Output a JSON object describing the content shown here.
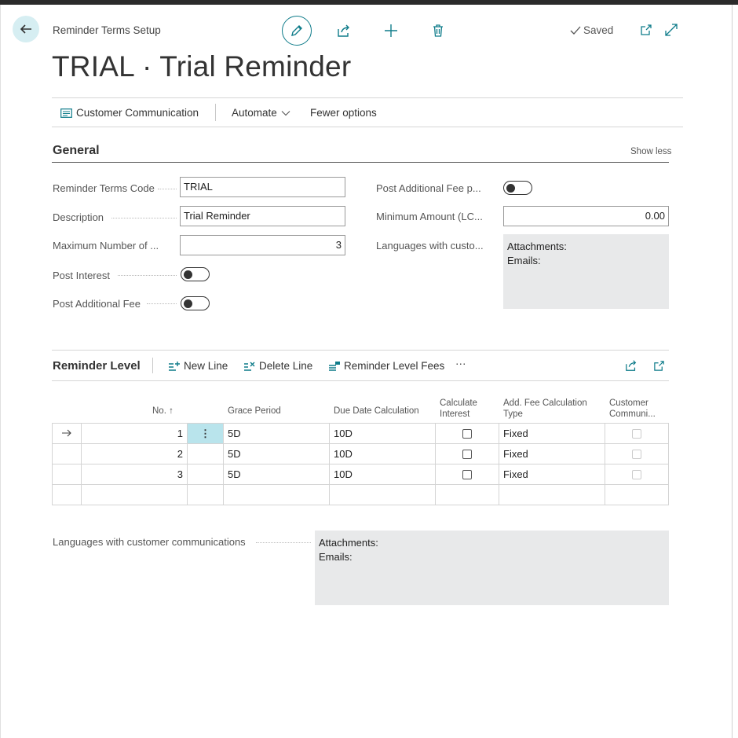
{
  "header": {
    "breadcrumb": "Reminder Terms Setup",
    "title": "TRIAL · Trial Reminder",
    "saved_label": "Saved"
  },
  "action_bar": {
    "customer_communication": "Customer Communication",
    "automate": "Automate",
    "fewer_options": "Fewer options"
  },
  "general": {
    "title": "General",
    "show_less": "Show less",
    "reminder_terms_code_label": "Reminder Terms Code",
    "reminder_terms_code_value": "TRIAL",
    "description_label": "Description",
    "description_value": "Trial Reminder",
    "max_number_label": "Maximum Number of ...",
    "max_number_value": "3",
    "post_interest_label": "Post Interest",
    "post_interest_value": "off",
    "post_additional_fee_label": "Post Additional Fee",
    "post_additional_fee_value": "off",
    "post_add_fee_p_label": "Post Additional Fee p...",
    "post_add_fee_p_value": "off",
    "minimum_amount_label": "Minimum Amount (LC...",
    "minimum_amount_value": "0.00",
    "languages_label": "Languages with custo...",
    "attachments_label": "Attachments:",
    "emails_label": "Emails:"
  },
  "reminder_level": {
    "title": "Reminder Level",
    "new_line": "New Line",
    "delete_line": "Delete Line",
    "level_fees": "Reminder Level Fees",
    "more": "···",
    "columns": {
      "no": "No. ↑",
      "grace_period": "Grace Period",
      "due_date_calc": "Due Date Calculation",
      "calc_interest_1": "Calculate",
      "calc_interest_2": "Interest",
      "add_fee_type_1": "Add. Fee Calculation",
      "add_fee_type_2": "Type",
      "cust_comm_1": "Customer",
      "cust_comm_2": "Communi..."
    },
    "rows": [
      {
        "no": "1",
        "grace": "5D",
        "due": "10D",
        "fee_type": "Fixed"
      },
      {
        "no": "2",
        "grace": "5D",
        "due": "10D",
        "fee_type": "Fixed"
      },
      {
        "no": "3",
        "grace": "5D",
        "due": "10D",
        "fee_type": "Fixed"
      }
    ]
  },
  "footer": {
    "languages_label": "Languages with customer communications",
    "attachments_label": "Attachments:",
    "emails_label": "Emails:"
  },
  "colors": {
    "accent": "#0f7c8a",
    "selected_cell": "#b9e4ec"
  }
}
